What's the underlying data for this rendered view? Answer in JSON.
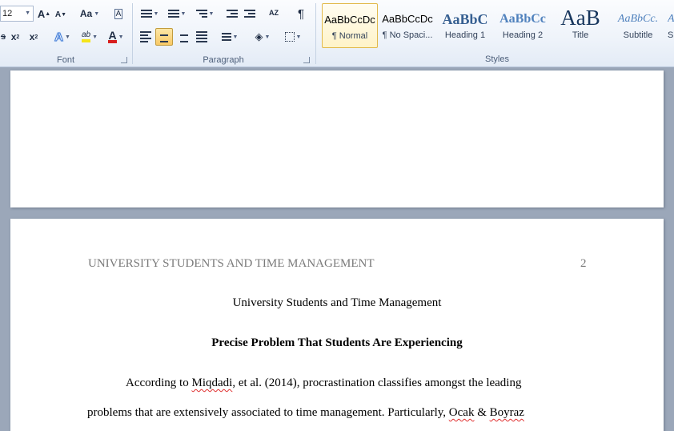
{
  "ribbon": {
    "font": {
      "label": "Font",
      "size_value": "12",
      "grow_icon": "A",
      "shrink_icon": "A",
      "case_label": "Aa",
      "clear_format_icon": "A",
      "strike_label": "abe",
      "subscript_label": "x",
      "superscript_label": "x",
      "text_effects_label": "A",
      "highlight_label": "ab",
      "font_color_label": "A",
      "accent_highlight": "#f5e51b",
      "accent_font_color": "#d81e1e"
    },
    "paragraph": {
      "label": "Paragraph",
      "sort_label": "AZ",
      "pilcrow": "¶"
    },
    "styles": {
      "label": "Styles",
      "items": [
        {
          "sample": "AaBbCcDc",
          "name": "¶ Normal"
        },
        {
          "sample": "AaBbCcDc",
          "name": "¶ No Spaci..."
        },
        {
          "sample": "AaBbC",
          "name": "Heading 1"
        },
        {
          "sample": "AaBbCc",
          "name": "Heading 2"
        },
        {
          "sample": "AaB",
          "name": "Title"
        },
        {
          "sample": "AaBbCc.",
          "name": "Subtitle"
        },
        {
          "sample": "A",
          "name": "S"
        }
      ]
    }
  },
  "document": {
    "header": "UNIVERSITY STUDENTS AND TIME MANAGEMENT",
    "page_number": "2",
    "title": "University Students and Time Management",
    "heading": "Precise Problem That Students Are Experiencing",
    "para_line1_pre": "According to ",
    "para_line1_name": "Miqdadi",
    "para_line1_post": ", et al. (2014), procrastination classifies amongst the leading",
    "para_line2_pre": "problems that are extensively associated to time management. Particularly, ",
    "para_line2_name1": "Ocak",
    "para_line2_mid": " & ",
    "para_line2_name2": "Boyraz"
  }
}
